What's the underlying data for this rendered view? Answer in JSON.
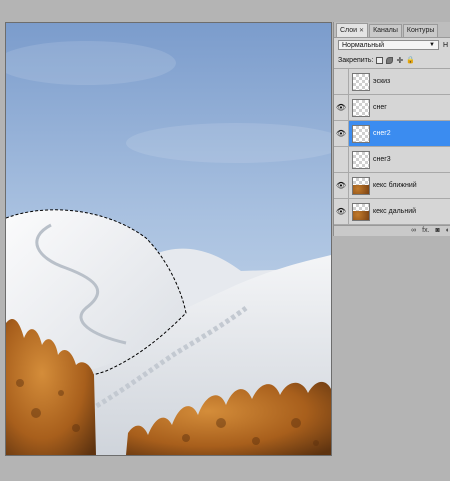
{
  "layers_panel": {
    "tabs": [
      {
        "label": "Слои",
        "active": true,
        "closable": true
      },
      {
        "label": "Каналы",
        "active": false
      },
      {
        "label": "Контуры",
        "active": false
      }
    ],
    "blend_mode": "Нормальный",
    "opacity_label_cut": "Н",
    "lock_label": "Закрепить:",
    "layers": [
      {
        "name": "эскиз",
        "visible": false,
        "selected": false,
        "thumb": "transparent"
      },
      {
        "name": "снег",
        "visible": true,
        "selected": false,
        "thumb": "transparent"
      },
      {
        "name": "снег2",
        "visible": true,
        "selected": true,
        "thumb": "transparent"
      },
      {
        "name": "снег3",
        "visible": false,
        "selected": false,
        "thumb": "transparent"
      },
      {
        "name": "кекс ближний",
        "visible": true,
        "selected": false,
        "thumb": "cake"
      },
      {
        "name": "кекс дальний",
        "visible": true,
        "selected": false,
        "thumb": "cake"
      }
    ],
    "bottom_icons": [
      "link-icon",
      "fx-icon",
      "mask-icon",
      "adjustment-icon"
    ],
    "bottom_fx_label": "fx."
  },
  "colors": {
    "sky_top": "#7f9fce",
    "sky_bottom": "#c6d8ea",
    "snow": "#f2f3f5",
    "selection_highlight": "#3b8cf0",
    "crust": "#b06a22"
  }
}
